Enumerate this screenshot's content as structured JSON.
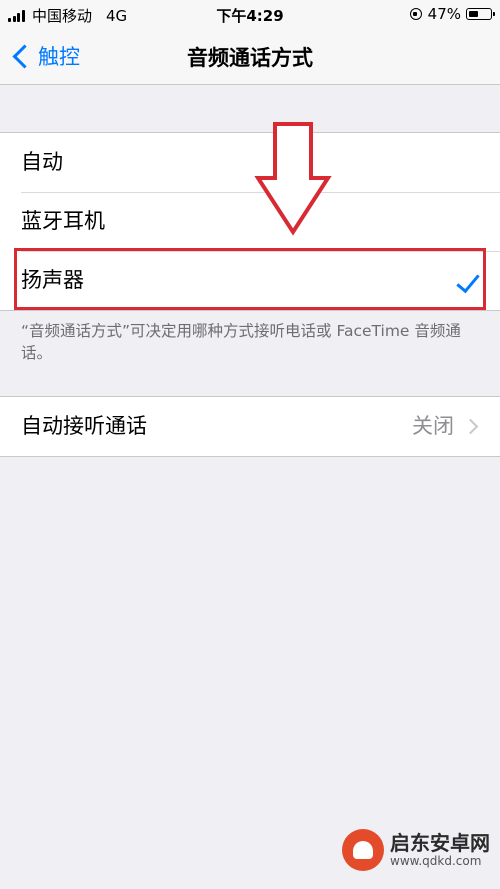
{
  "status_bar": {
    "carrier": "中国移动",
    "network": "4G",
    "time": "下午4:29",
    "battery": "47%",
    "battery_level": 0.47
  },
  "nav": {
    "back_label": "触控",
    "title": "音频通话方式"
  },
  "audio_routing": {
    "options": [
      {
        "label": "自动",
        "selected": false
      },
      {
        "label": "蓝牙耳机",
        "selected": false
      },
      {
        "label": "扬声器",
        "selected": true
      }
    ],
    "footer": "“音频通话方式”可决定用哪种方式接听电话或 FaceTime 音频通话。"
  },
  "auto_answer": {
    "label": "自动接听通话",
    "value": "关闭"
  },
  "colors": {
    "accent": "#007aff",
    "annotation": "#d72a33",
    "background": "#efeff4"
  },
  "watermark": {
    "name": "启东安卓网",
    "domain": "www.qdkd.com"
  }
}
